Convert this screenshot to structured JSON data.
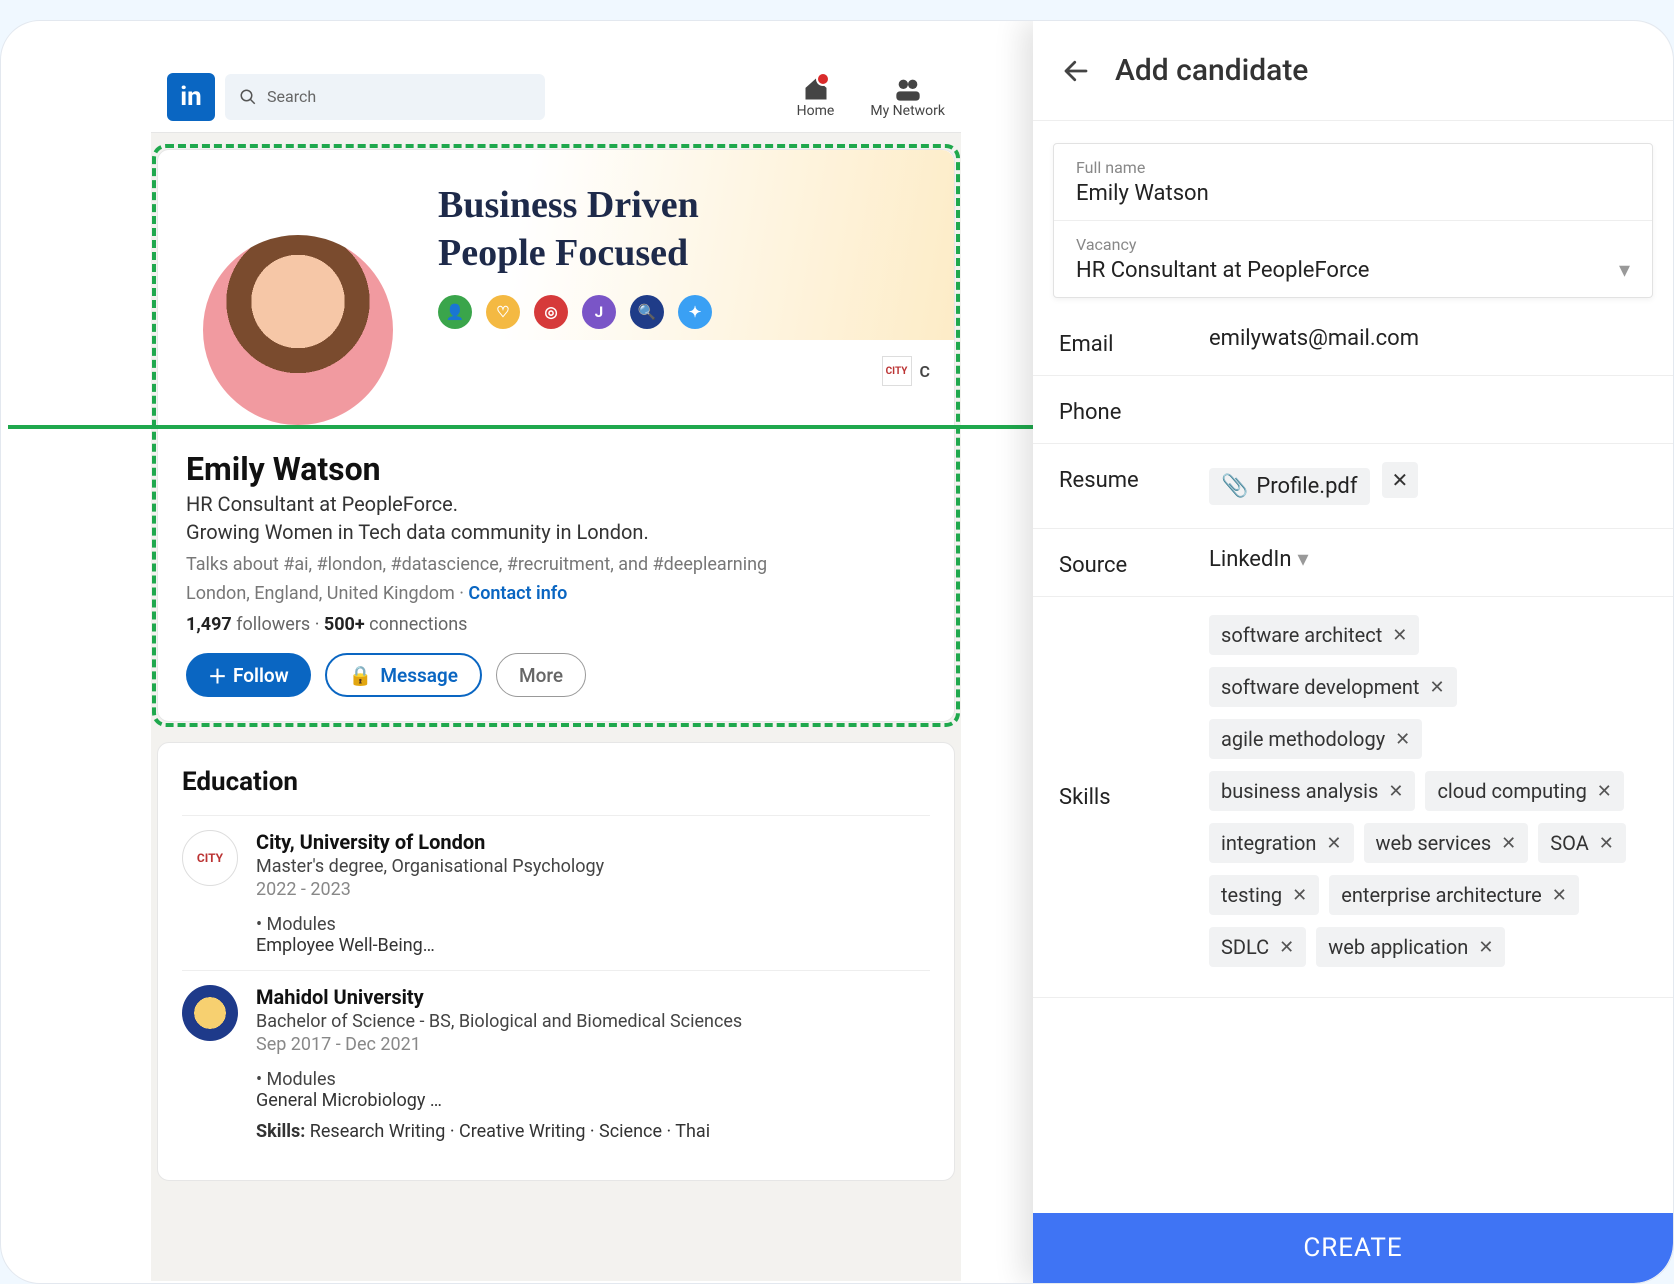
{
  "nav": {
    "search_placeholder": "Search",
    "home": "Home",
    "network": "My Network"
  },
  "cover": {
    "line1": "Business Driven",
    "line2": "People Focused"
  },
  "profile": {
    "name": "Emily Watson",
    "title": "HR Consultant at PeopleForce.",
    "subtitle": "Growing Women in Tech data community in London.",
    "talks": "Talks about #ai, #london, #datascience, #recruitment, and #deeplearning",
    "location": "London, England, United Kingdom",
    "contact": "Contact info",
    "followers_n": "1,497",
    "followers_l": "followers",
    "connections_n": "500+",
    "connections_l": "connections",
    "org_short": "C",
    "follow": "Follow",
    "message": "Message",
    "more": "More"
  },
  "education": {
    "heading": "Education",
    "items": [
      {
        "school": "City, University of London",
        "degree": "Master's degree, Organisational Psychology",
        "dates": "2022 - 2023",
        "modules_label": "• Modules",
        "modules_text": "Employee Well-Being…"
      },
      {
        "school": "Mahidol University",
        "degree": "Bachelor of Science - BS, Biological and Biomedical Sciences",
        "dates": "Sep 2017 - Dec 2021",
        "modules_label": "• Modules",
        "modules_text": "General Microbiology …",
        "skills_label": "Skills:",
        "skills_text": " Research Writing · Creative Writing · Science · Thai"
      }
    ]
  },
  "panel": {
    "title": "Add candidate",
    "full_name_label": "Full name",
    "full_name_value": "Emily Watson",
    "vacancy_label": "Vacancy",
    "vacancy_value": "HR Consultant at PeopleForce",
    "email_label": "Email",
    "email_value": "emilywats@mail.com",
    "phone_label": "Phone",
    "phone_value": "",
    "resume_label": "Resume",
    "resume_file": "Profile.pdf",
    "source_label": "Source",
    "source_value": "LinkedIn",
    "skills_label": "Skills",
    "skills": [
      "software architect",
      "software development",
      "agile methodology",
      "business analysis",
      "cloud computing",
      "integration",
      "web services",
      "SOA",
      "testing",
      "enterprise architecture",
      "SDLC",
      "web application"
    ],
    "create": "CREATE"
  }
}
